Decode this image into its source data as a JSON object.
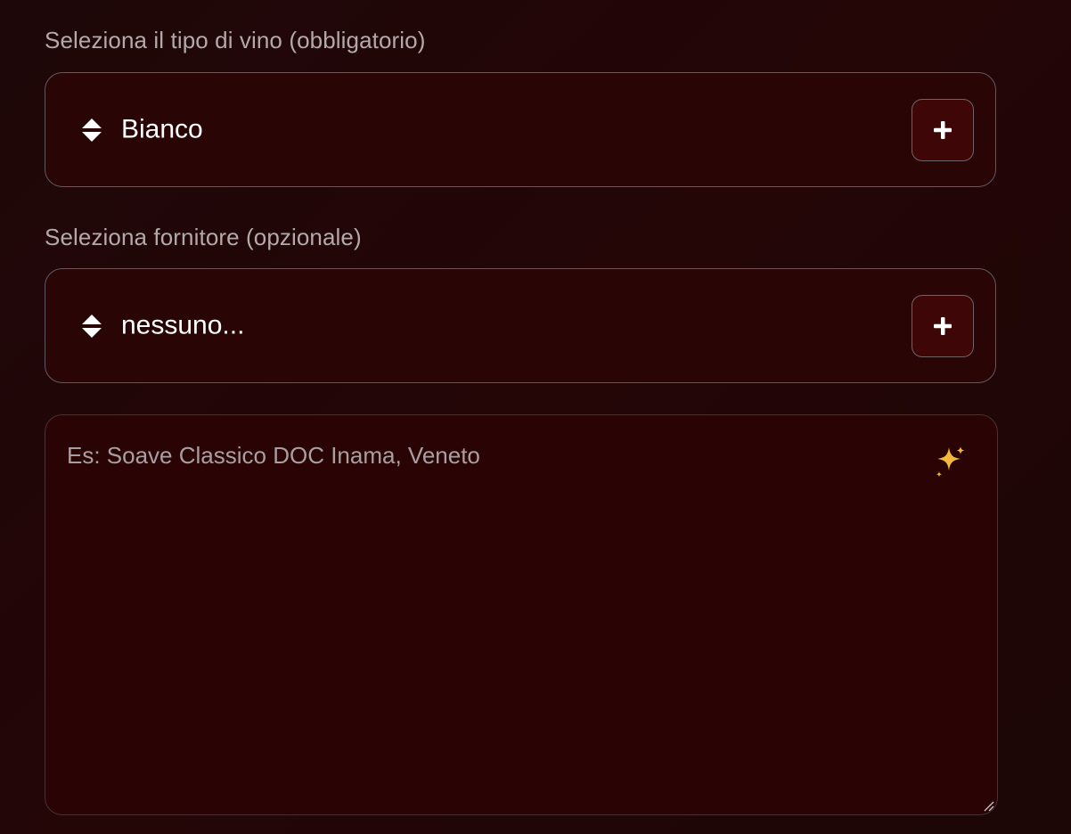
{
  "wine_type": {
    "label": "Seleziona il tipo di vino (obbligatorio)",
    "selected": "Bianco",
    "add_icon": "plus-icon"
  },
  "supplier": {
    "label": "Seleziona fornitore (opzionale)",
    "selected": "nessuno...",
    "add_icon": "plus-icon"
  },
  "description": {
    "placeholder": "Es: Soave Classico DOC Inama, Veneto",
    "icon": "sparkles-icon"
  },
  "colors": {
    "background": "#220607",
    "field_background": "#2a0506",
    "button_background": "#3f0607",
    "sparkle": "#f5b83d"
  }
}
